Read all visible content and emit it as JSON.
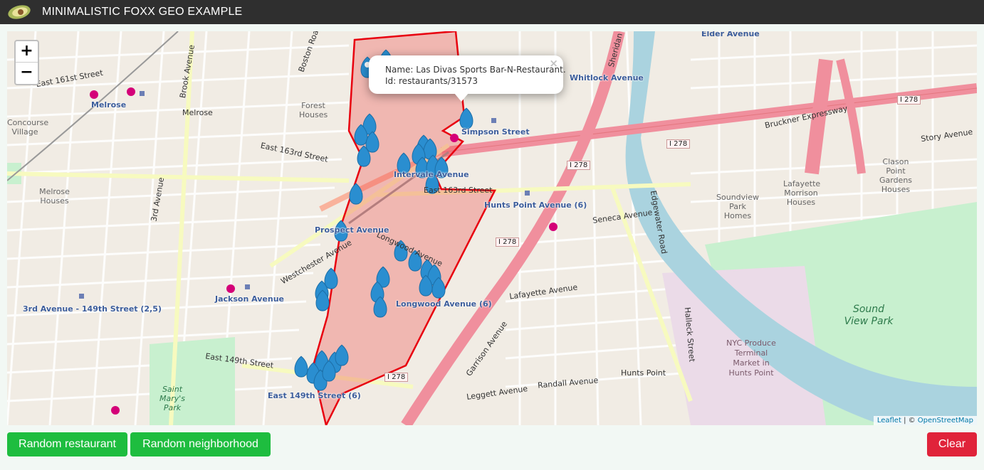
{
  "header": {
    "title": "MINIMALISTIC FOXX GEO EXAMPLE",
    "logo_icon": "avocado-logo-icon"
  },
  "map": {
    "zoom_in": "+",
    "zoom_out": "−",
    "popup": {
      "name_line": "Name: Las Divas Sports Bar-N-Restaurant.",
      "id_line": "Id: restaurants/31573",
      "close": "×"
    },
    "attribution": {
      "leaflet": "Leaflet",
      "separator": " | © ",
      "osm": "OpenStreetMap"
    },
    "labels": {
      "elder_avenue": "Elder Avenue",
      "whitlock_avenue": "Whitlock Avenue",
      "melrose_station": "Melrose",
      "melrose": "Melrose",
      "simpson_street": "Simpson Street",
      "intervale_avenue": "Intervale Avenue",
      "hunts_point_avenue": "Hunts Point Avenue (6)",
      "prospect_avenue": "Prospect Avenue",
      "longwood_avenue": "Longwood Avenue (6)",
      "jackson_avenue": "Jackson Avenue",
      "third_ave_149": "3rd Avenue - 149th Street (2,5)",
      "east_149_station": "East 149th Street (6)",
      "east_161": "East 161st Street",
      "east_163": "East 163rd Street",
      "east_149": "East 149th Street",
      "bruckner_expressway": "Bruckner Expressway",
      "east_163_street": "East 163rd Street",
      "forest_houses": "Forest Houses",
      "concourse_village": "Concourse Village",
      "melrose_houses": "Melrose Houses",
      "soundview_park_homes": "Soundview Park Homes",
      "lafayette_morrison": "Lafayette Morrison Houses",
      "clason_point": "Clason Point Gardens Houses",
      "hunts_point": "Hunts Point",
      "westchester_avenue": "Westchester Avenue",
      "longwood_avenue_street": "Longwood Avenue",
      "lafayette_avenue": "Lafayette Avenue",
      "randall_avenue": "Randall Avenue",
      "edgewater_road": "Edgewater Road",
      "halleck_street": "Halleck Street",
      "story_avenue": "Story Avenue",
      "seneca_avenue": "Seneca Avenue",
      "garrison_avenue": "Garrison Avenue",
      "leggett_avenue": "Leggett Avenue",
      "third_avenue": "3rd Avenue",
      "boston_road": "Boston Road",
      "brook_avenue": "Brook Avenue",
      "sheridan": "Sheridan"
    },
    "park_names": {
      "sound_view_park": "Sound View Park",
      "saint_marys_park": "Saint Mary's Park"
    },
    "market_name": "NYC Produce Terminal Market in Hunts Point",
    "shields": {
      "i278_a": "I 278",
      "i278_b": "I 278",
      "i278_c": "I 278",
      "i278_d": "I 278",
      "i278_e": "I 278"
    },
    "marker_count_label": "restaurant markers",
    "colors": {
      "marker": "#2a8ed0",
      "boundary": "#e8000f",
      "highway": "#f08f9d",
      "water": "#aad3df",
      "park": "#c8f0cf"
    }
  },
  "actions": {
    "random_restaurant": "Random restaurant",
    "random_neighborhood": "Random neighborhood",
    "clear": "Clear"
  }
}
